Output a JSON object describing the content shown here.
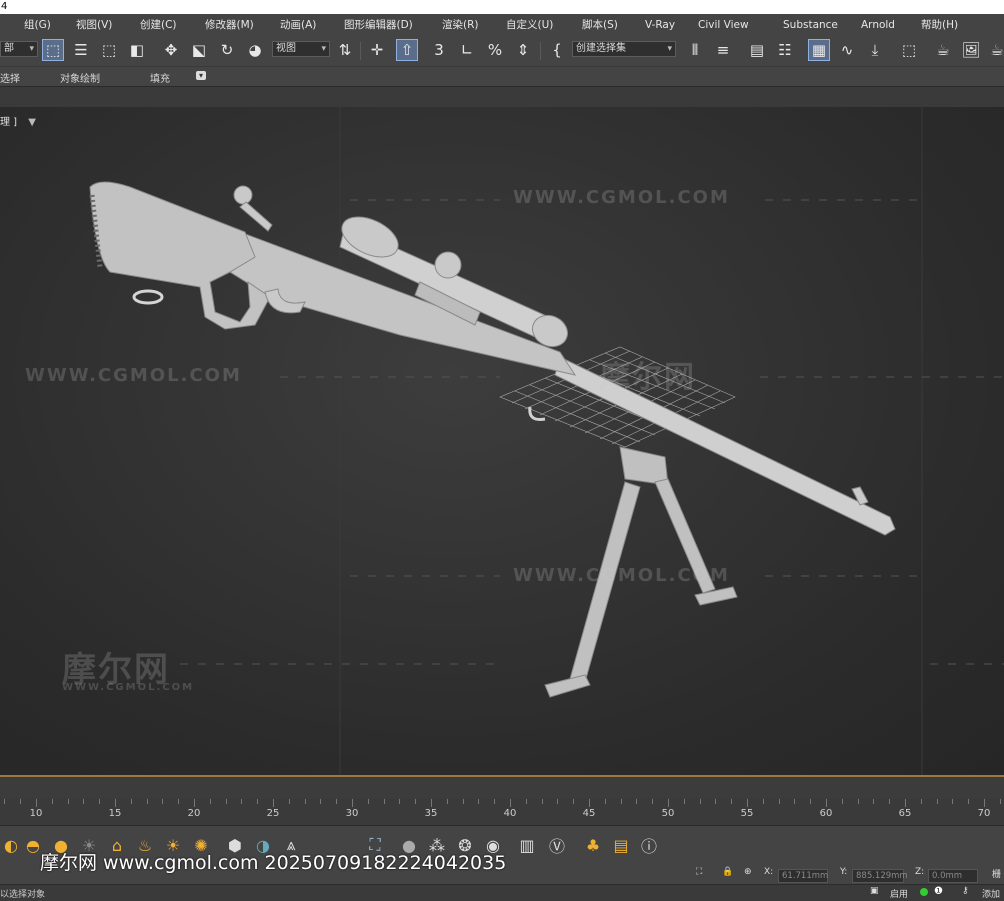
{
  "window": {
    "title_fragment": "4"
  },
  "menu": [
    "组(G)",
    "视图(V)",
    "创建(C)",
    "修改器(M)",
    "动画(A)",
    "图形编辑器(D)",
    "渲染(R)",
    "自定义(U)",
    "脚本(S)",
    "V-Ray",
    "Civil View",
    "Substance",
    "Arnold",
    "帮助(H)"
  ],
  "toolbar": {
    "selection_dropdown": "部",
    "reference_dropdown": "视图",
    "named_selection_dropdown": "创建选择集",
    "snap_label": "3"
  },
  "ribbon": {
    "tab_select": "选择",
    "tab_object_paint": "对象绘制",
    "tab_fill": "填充"
  },
  "viewport": {
    "label": "理 ]",
    "watermarks": [
      "WWW.CGMOL.COM",
      "WWW.CGMOL.COM",
      "WWW.CGMOL.COM",
      "摩尔网",
      "摩尔网",
      "WWW.CGMOL.COM"
    ]
  },
  "timeline": {
    "ticks": [
      "10",
      "15",
      "20",
      "25",
      "30",
      "35",
      "40",
      "45",
      "50",
      "55",
      "60",
      "65",
      "70"
    ]
  },
  "footer": {
    "watermark_text": "摩尔网 www.cgmol.com 20250709182224042035",
    "status_left": "以选择对象",
    "coord_x_label": "X:",
    "coord_x_value": "61.711mm",
    "coord_y_label": "Y:",
    "coord_y_value": "885.129mm",
    "coord_z_label": "Z:",
    "coord_z_value": "0.0mm",
    "grid_label": "栅",
    "enable_label": "启用",
    "add_label": "添加"
  },
  "colors": {
    "accent": "#8fb0e0",
    "timeline_bar": "#9a7a3a",
    "viewport_bg": "#2b2b2b"
  }
}
